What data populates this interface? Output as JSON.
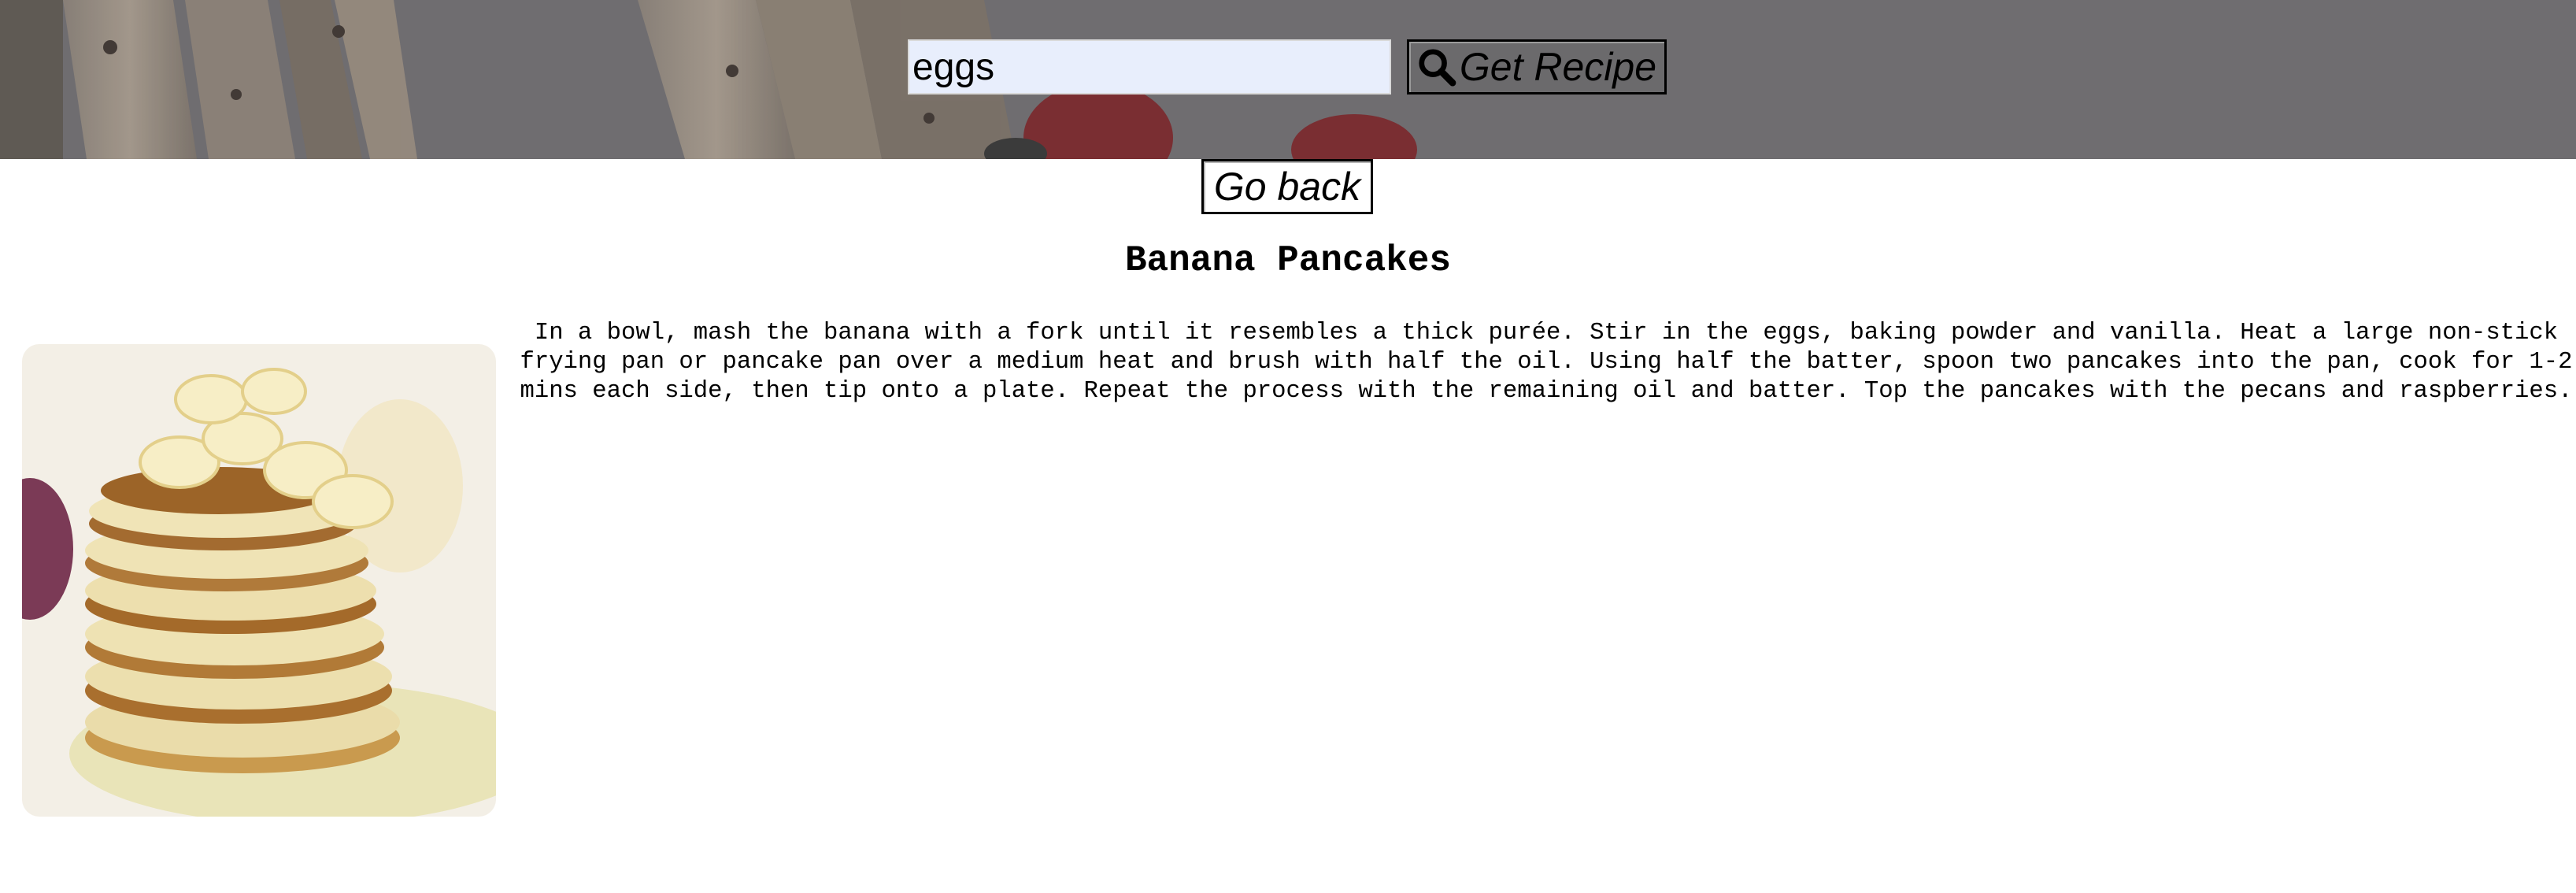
{
  "search": {
    "value": "eggs",
    "button_label": "Get Recipe",
    "button_icon": "search-icon"
  },
  "navigation": {
    "go_back_label": "Go back"
  },
  "recipe": {
    "title": "Banana Pancakes",
    "instructions": "In a bowl, mash the banana with a fork until it resembles a thick purée. Stir in the eggs, baking powder and vanilla. Heat a large non-stick frying pan or pancake pan over a medium heat and brush with half the oil. Using half the batter, spoon two pancakes into the pan, cook for 1-2 mins each side, then tip onto a plate. Repeat the process with the remaining oil and batter. Top the pancakes with the pecans and raspberries."
  },
  "colors": {
    "search_input_bg": "#e8eefc",
    "hero_overlay": "#6f6d70",
    "button_bg": "#6b6a6c"
  }
}
